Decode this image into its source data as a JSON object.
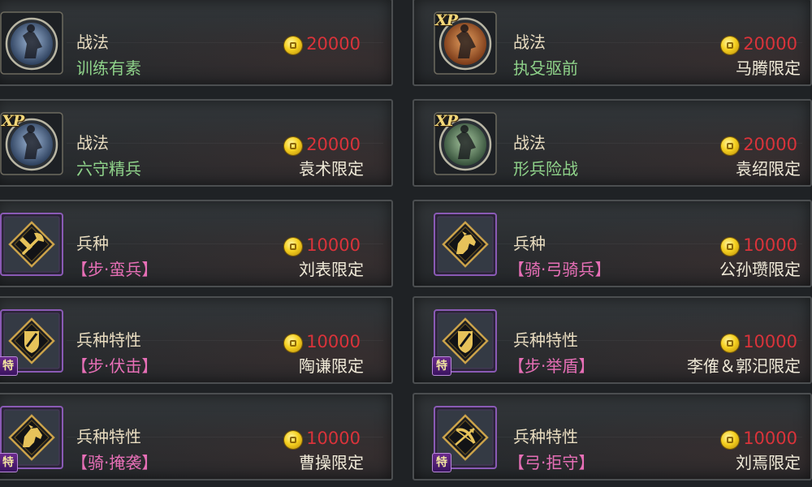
{
  "colors": {
    "card_background": "#2b2e31",
    "card_border": "#4b4e50",
    "category_text": "#e8dcc0",
    "skill_green": "#8fd38a",
    "unit_pink": "#e66fb6",
    "price_red": "#d9333a",
    "restrict_text": "#f0ead8",
    "coin_gold": "#f5d020"
  },
  "xp_label": "XP",
  "trait_badge": "特",
  "items": [
    {
      "category": "战法",
      "name": "训练有素",
      "name_color": "green",
      "price": "20000",
      "restriction": "",
      "icon": "tactic-warrior-blue-icon",
      "badge": "none"
    },
    {
      "category": "战法",
      "name": "执殳驱前",
      "name_color": "green",
      "price": "20000",
      "restriction": "马腾限定",
      "icon": "tactic-warrior-orange-icon",
      "badge": "xp"
    },
    {
      "category": "战法",
      "name": "六守精兵",
      "name_color": "green",
      "price": "20000",
      "restriction": "袁术限定",
      "icon": "tactic-warrior-blue-icon",
      "badge": "xp"
    },
    {
      "category": "战法",
      "name": "形兵险战",
      "name_color": "green",
      "price": "20000",
      "restriction": "袁绍限定",
      "icon": "tactic-warrior-green-icon",
      "badge": "xp"
    },
    {
      "category": "兵种",
      "name": "【步·蛮兵】",
      "name_color": "pink",
      "price": "10000",
      "restriction": "刘表限定",
      "icon": "axe-emblem-icon",
      "badge": "none"
    },
    {
      "category": "兵种",
      "name": "【骑·弓骑兵】",
      "name_color": "pink",
      "price": "10000",
      "restriction": "公孙瓒限定",
      "icon": "horse-head-emblem-icon",
      "badge": "none"
    },
    {
      "category": "兵种特性",
      "name": "【步·伏击】",
      "name_color": "pink",
      "price": "10000",
      "restriction": "陶谦限定",
      "icon": "shield-emblem-icon",
      "badge": "trait"
    },
    {
      "category": "兵种特性",
      "name": "【步·举盾】",
      "name_color": "pink",
      "price": "10000",
      "restriction": "李傕＆郭汜限定",
      "icon": "shield-emblem-icon",
      "badge": "trait"
    },
    {
      "category": "兵种特性",
      "name": "【骑·掩袭】",
      "name_color": "pink",
      "price": "10000",
      "restriction": "曹操限定",
      "icon": "horse-head-emblem-icon",
      "badge": "trait"
    },
    {
      "category": "兵种特性",
      "name": "【弓·拒守】",
      "name_color": "pink",
      "price": "10000",
      "restriction": "刘焉限定",
      "icon": "bow-emblem-icon",
      "badge": "trait"
    }
  ]
}
